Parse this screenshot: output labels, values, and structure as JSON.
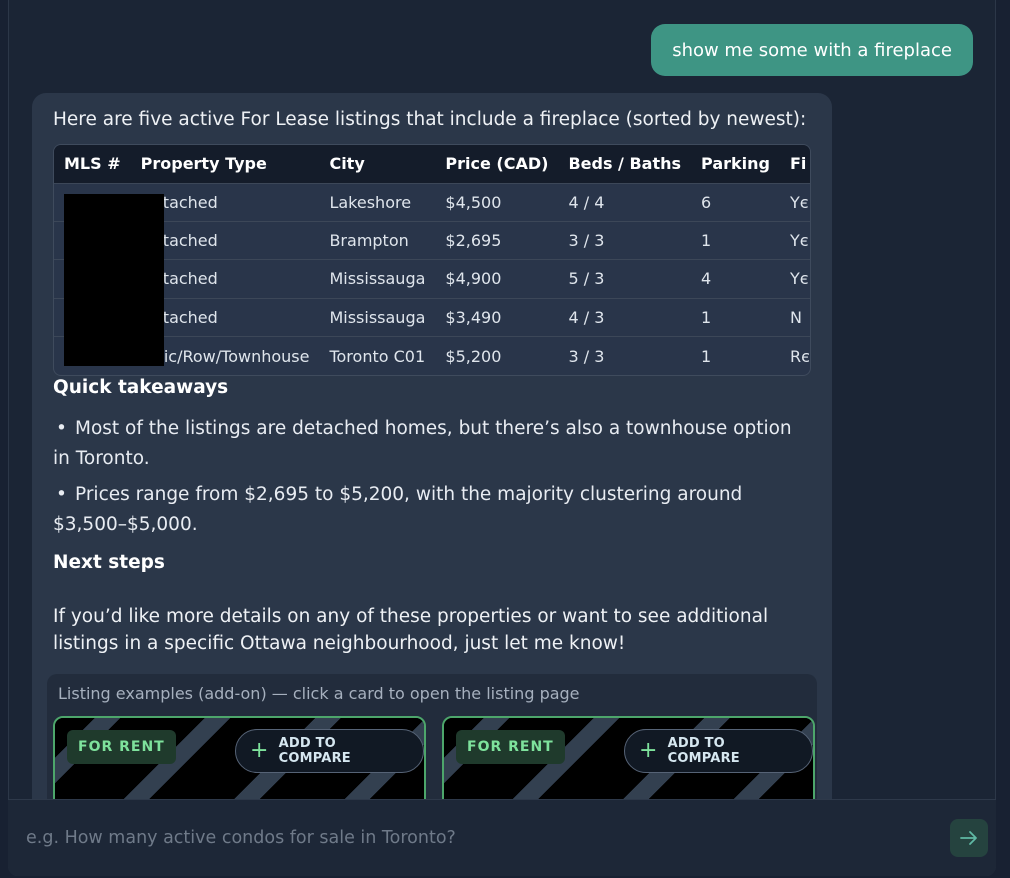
{
  "user_message": "show me some with a fireplace",
  "assistant": {
    "intro": "Here are five active For Lease listings that include a fireplace (sorted by newest):",
    "table": {
      "headers": [
        "MLS #",
        "Property Type",
        "City",
        "Price (CAD)",
        "Beds / Baths",
        "Parking",
        "Fi"
      ],
      "rows": [
        {
          "type": "Detached",
          "city": "Lakeshore",
          "price": "$4,500",
          "beds_baths": "4 / 4",
          "parking": "6",
          "extra": "Yє"
        },
        {
          "type": "Detached",
          "city": "Brampton",
          "price": "$2,695",
          "beds_baths": "3 / 3",
          "parking": "1",
          "extra": "Yє"
        },
        {
          "type": "Detached",
          "city": "Mississauga",
          "price": "$4,900",
          "beds_baths": "5 / 3",
          "parking": "4",
          "extra": "Yє"
        },
        {
          "type": "Detached",
          "city": "Mississauga",
          "price": "$3,490",
          "beds_baths": "4 / 3",
          "parking": "1",
          "extra": "N"
        },
        {
          "type": "Attic/Row/Townhouse",
          "city": "Toronto C01",
          "price": "$5,200",
          "beds_baths": "3 / 3",
          "parking": "1",
          "extra": "Rє"
        }
      ]
    },
    "takeaways_heading": "Quick takeaways",
    "takeaways": [
      "Most of the listings are detached homes, but there’s also a townhouse option in Toronto.",
      "Prices range from $2,695 to $5,200, with the majority clustering around $3,500–$5,000."
    ],
    "next_heading": "Next steps",
    "next_text": "If you’d like more details on any of these properties or want to see additional listings in a specific Ottawa neighbourhood, just let me know!",
    "addon": {
      "title": "Listing examples (add-on) — click a card to open the listing page",
      "cards": [
        {
          "badge": "FOR RENT",
          "compare_label": "ADD TO COMPARE"
        },
        {
          "badge": "FOR RENT",
          "compare_label": "ADD TO COMPARE"
        }
      ]
    }
  },
  "composer": {
    "placeholder": "e.g. How many active condos for sale in Toronto?"
  }
}
